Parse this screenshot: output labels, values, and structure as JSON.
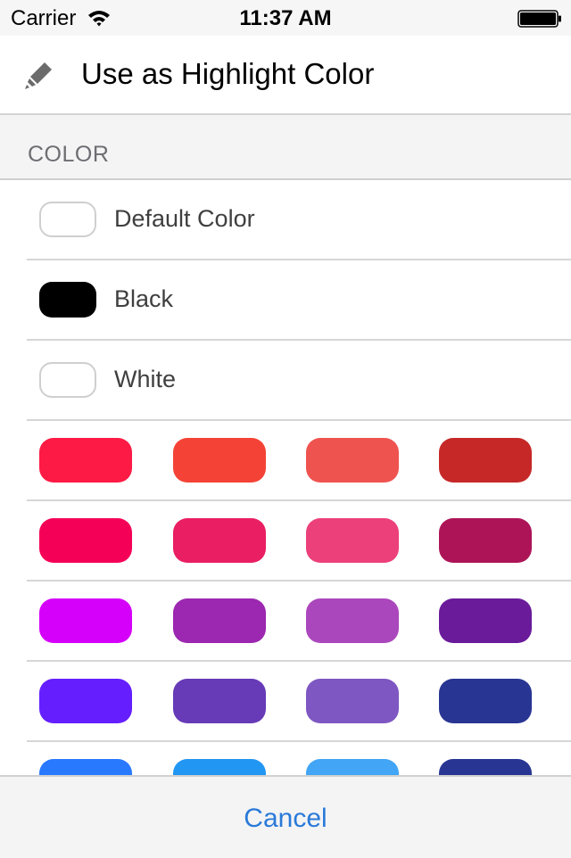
{
  "status_bar": {
    "carrier": "Carrier",
    "time": "11:37 AM",
    "wifi_icon": "wifi-icon",
    "battery_icon": "battery-full-icon",
    "battery_level": 1.0
  },
  "header": {
    "icon": "highlighter-icon",
    "title": "Use as Highlight Color"
  },
  "section": {
    "title": "COLOR"
  },
  "named_colors": [
    {
      "label": "Default Color",
      "color": "#ffffff",
      "outlined": true
    },
    {
      "label": "Black",
      "color": "#000000",
      "outlined": false
    },
    {
      "label": "White",
      "color": "#ffffff",
      "outlined": true
    }
  ],
  "palette_rows": [
    [
      "#fd1a44",
      "#f44336",
      "#ef5350",
      "#c62828"
    ],
    [
      "#f50057",
      "#e91e63",
      "#ec407a",
      "#ad1457"
    ],
    [
      "#d500f9",
      "#9c27b0",
      "#ab47bc",
      "#6a1b9a"
    ],
    [
      "#651fff",
      "#673ab7",
      "#7e57c2",
      "#283593"
    ],
    [
      "#2979ff",
      "#2196f3",
      "#42a5f5",
      "#283593"
    ]
  ],
  "footer": {
    "cancel_label": "Cancel"
  },
  "colors": {
    "accent": "#2a7ad8",
    "section_bg": "#f4f4f5",
    "separator": "#d6d6d6"
  }
}
